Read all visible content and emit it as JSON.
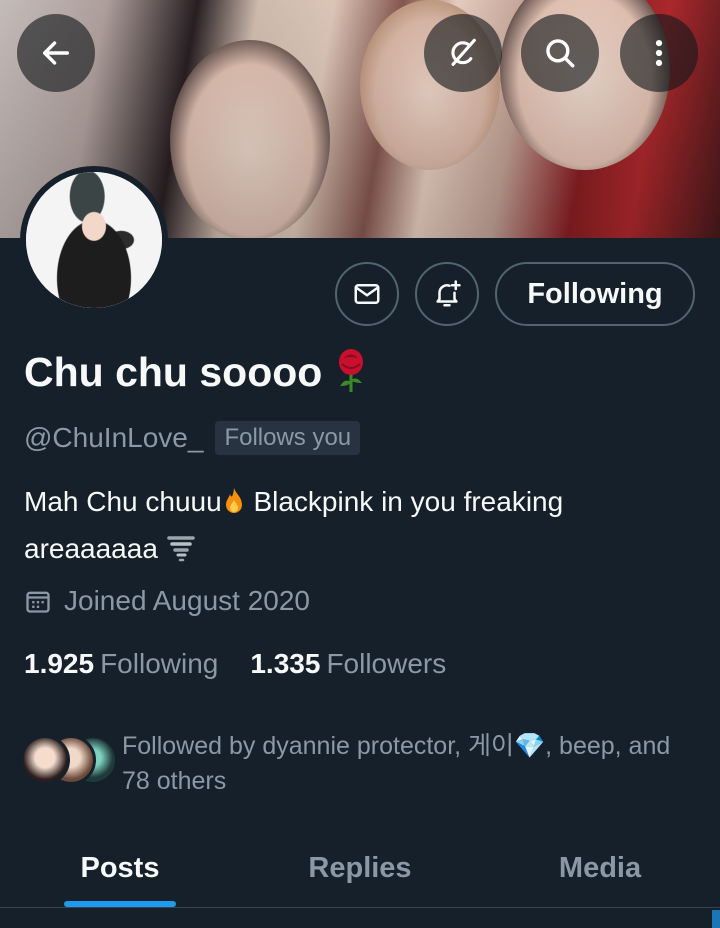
{
  "profile": {
    "display_name": "Chu chu soooo",
    "handle": "@ChuInLove_",
    "follows_you_badge": "Follows you",
    "bio_part1": "Mah Chu chuuu",
    "bio_part2": " Blackpink in you freaking areaaaaaa",
    "joined": "Joined August 2020"
  },
  "stats": {
    "following_count": "1.925",
    "following_label": "Following",
    "followers_count": "1.335",
    "followers_label": "Followers"
  },
  "followed_by": {
    "text": "Followed by dyannie protector, 게이💎, beep, and 78 others"
  },
  "actions": {
    "follow_button": "Following"
  },
  "tabs": [
    {
      "label": "Posts",
      "active": true
    },
    {
      "label": "Replies",
      "active": false
    },
    {
      "label": "Media",
      "active": false
    }
  ],
  "icons": {
    "back": "arrow-left-icon",
    "grok": "grok-icon",
    "search": "search-icon",
    "more": "more-vertical-icon",
    "message": "envelope-icon",
    "notify": "bell-plus-icon",
    "calendar": "calendar-icon"
  },
  "colors": {
    "background": "#15202b",
    "accent": "#1d9bf0",
    "secondary_text": "#8b98a5",
    "border": "#536471"
  }
}
